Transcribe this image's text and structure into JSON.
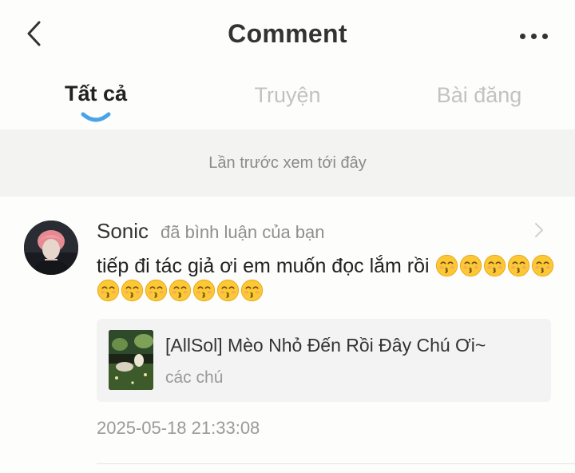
{
  "header": {
    "title": "Comment",
    "back_icon": "chevron-left-icon",
    "more_icon": "more-horizontal-icon"
  },
  "tabs": [
    {
      "label": "Tất cả",
      "active": true
    },
    {
      "label": "Truyện",
      "active": false
    },
    {
      "label": "Bài đăng",
      "active": false
    }
  ],
  "divider": {
    "text": "Lần trước xem tới đây"
  },
  "comment": {
    "username": "Sonic",
    "action": "đã bình luận của bạn",
    "text": "tiếp đi tác giả ơi em muốn đọc lắm rồi",
    "emoji": "kissing-face-with-smiling-eyes",
    "emoji_count": 12,
    "story": {
      "title": "[AllSol] Mèo Nhỏ Đến Rồi Đây Chú Ơi~",
      "subtitle": "các chú"
    },
    "timestamp": "2025-05-18 21:33:08"
  },
  "colors": {
    "accent": "#4aa3e8",
    "muted": "#c2c2c2",
    "band": "#f3f3f1"
  }
}
